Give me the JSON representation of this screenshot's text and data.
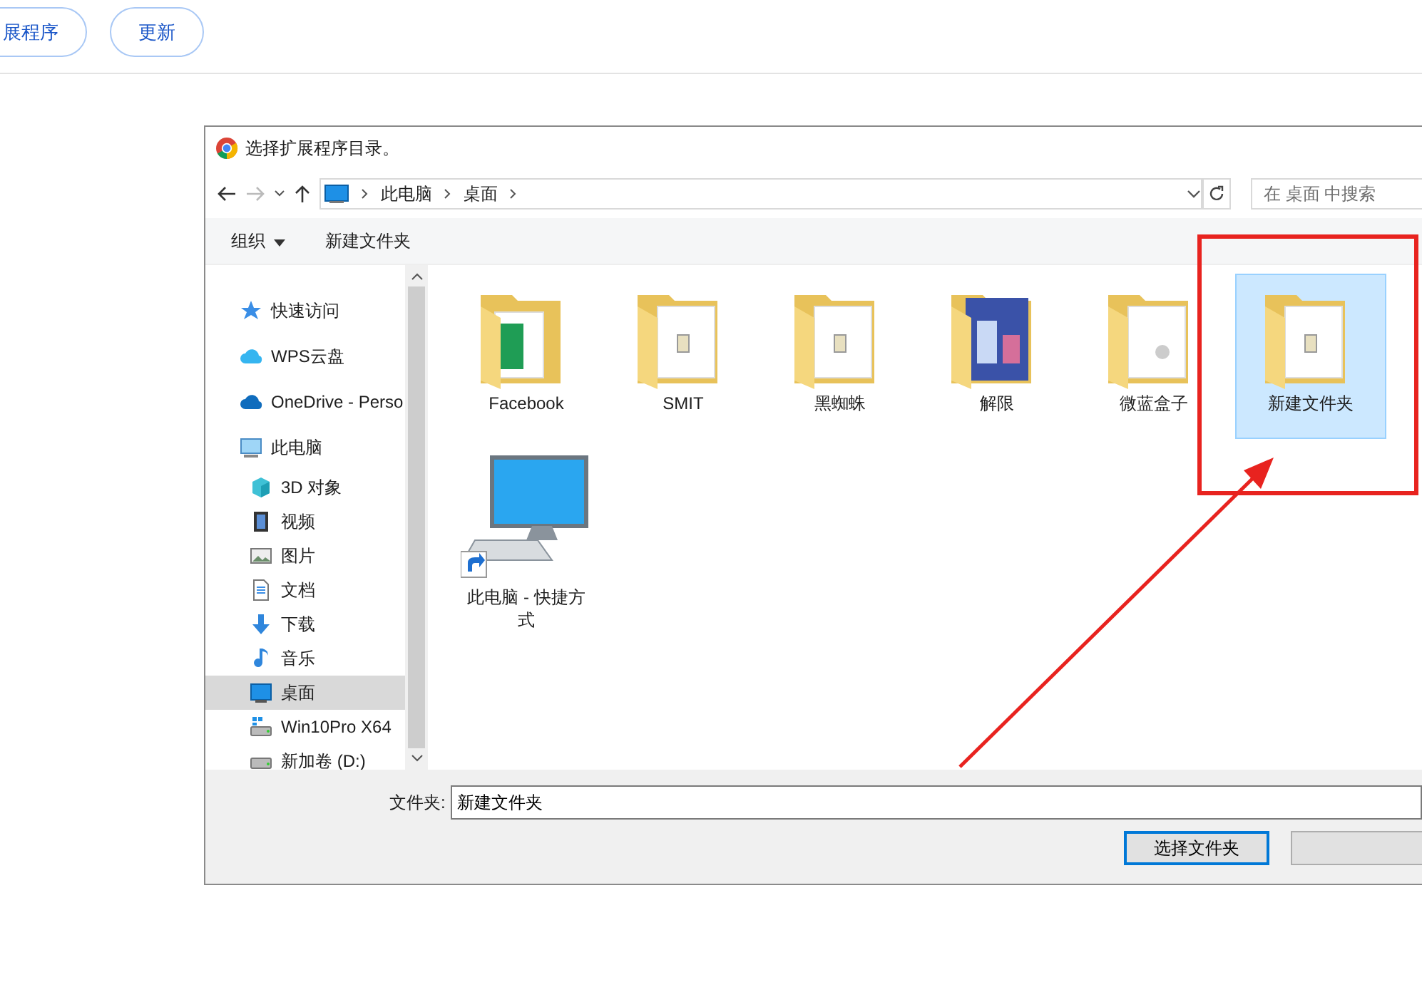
{
  "top_buttons": [
    {
      "label": "展程序"
    },
    {
      "label": "更新"
    }
  ],
  "dialog": {
    "title": "选择扩展程序目录。",
    "path": [
      "此电脑",
      "桌面"
    ],
    "search": {
      "placeholder": "在 桌面 中搜索"
    },
    "toolbar": [
      {
        "label": "组织",
        "dropdown": true
      },
      {
        "label": "新建文件夹",
        "dropdown": false
      }
    ],
    "sidebar": [
      {
        "label": "快速访问",
        "selected": false
      },
      {
        "label": "WPS云盘",
        "selected": false
      },
      {
        "label": "OneDrive - Perso",
        "selected": false
      },
      {
        "label": "此电脑",
        "selected": false,
        "children": [
          {
            "label": "3D 对象",
            "selected": false
          },
          {
            "label": "视频",
            "selected": false
          },
          {
            "label": "图片",
            "selected": false
          },
          {
            "label": "文档",
            "selected": false
          },
          {
            "label": "下载",
            "selected": false
          },
          {
            "label": "音乐",
            "selected": false
          },
          {
            "label": "桌面",
            "selected": true
          },
          {
            "label": "Win10Pro X64",
            "selected": false
          },
          {
            "label": "新加卷 (D:)",
            "selected": false
          }
        ]
      }
    ],
    "items": [
      {
        "label": "Facebook",
        "kind": "folder",
        "selected": false
      },
      {
        "label": "SMIT",
        "kind": "folder",
        "selected": false
      },
      {
        "label": "黑蜘蛛",
        "kind": "folder",
        "selected": false
      },
      {
        "label": "解限",
        "kind": "folder",
        "selected": false
      },
      {
        "label": "微蓝盒子",
        "kind": "folder",
        "selected": false
      },
      {
        "label": "新建文件夹",
        "kind": "folder",
        "selected": true
      },
      {
        "label": "此电脑 - 快捷方式",
        "kind": "shortcut",
        "selected": false
      }
    ],
    "folder_field": {
      "label": "文件夹:",
      "value": "新建文件夹"
    },
    "buttons": [
      {
        "label": "选择文件夹",
        "default": true
      },
      {
        "default": false
      }
    ]
  },
  "annotation": {
    "highlight_box": true,
    "arrow": true
  }
}
